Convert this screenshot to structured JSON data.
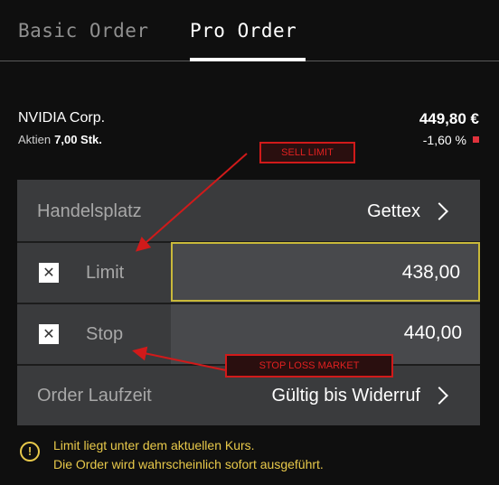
{
  "tabs": {
    "basic": "Basic Order",
    "pro": "Pro Order"
  },
  "stock": {
    "name": "NVIDIA Corp.",
    "type_label": "Aktien",
    "quantity": "7,00 Stk.",
    "price": "449,80 €",
    "change": "-1,60 %"
  },
  "order": {
    "handelsplatz_label": "Handelsplatz",
    "handelsplatz_value": "Gettex",
    "limit_label": "Limit",
    "limit_checked": true,
    "limit_value": "438,00",
    "stop_label": "Stop",
    "stop_checked": true,
    "stop_value": "440,00",
    "laufzeit_label": "Order Laufzeit",
    "laufzeit_value": "Gültig bis Widerruf"
  },
  "annotations": {
    "sell_limit": "SELL LIMIT",
    "stop_loss": "STOP LOSS MARKET"
  },
  "warning": {
    "line1": "Limit liegt unter dem aktuellen Kurs.",
    "line2": "Die Order wird wahrscheinlich sofort ausgeführt."
  },
  "icons": {
    "checkbox": "x-mark",
    "chevron": "chevron-right-icon",
    "warning": "exclamation-circle-icon"
  },
  "colors": {
    "background": "#0f0f0f",
    "panel": "#3a3b3d",
    "active_border": "#c9b93a",
    "warning": "#e8c94a",
    "negative": "#e0323c",
    "annotation": "#d11a1a"
  }
}
